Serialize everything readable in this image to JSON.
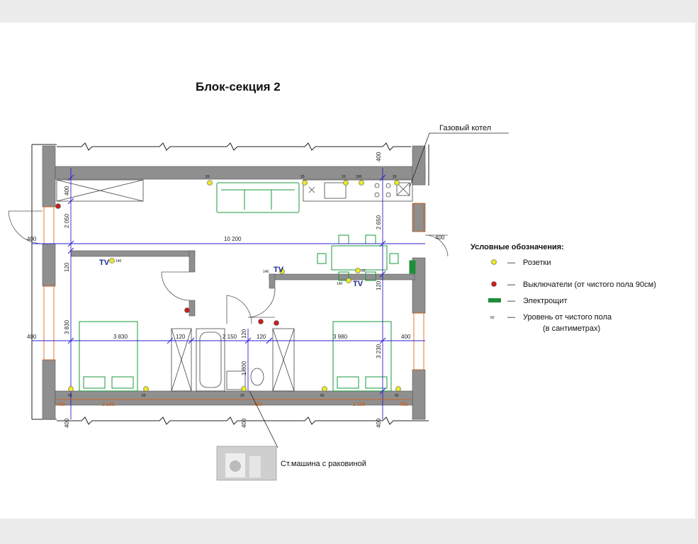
{
  "title": "Блок-секция 2",
  "callouts": {
    "gas_boiler": "Газовый котел",
    "washer": "Ст.машина с раковиной"
  },
  "legend": {
    "title": "Условные обозначения:",
    "items": [
      {
        "symbol": "socket",
        "color": "#e8e82a",
        "dash": "—",
        "label": "Розетки"
      },
      {
        "symbol": "switch",
        "color": "#c81e1e",
        "dash": "—",
        "label": "Выключатели (от чистого пола 90см)"
      },
      {
        "symbol": "panel",
        "color": "#1e8c3a",
        "dash": "—",
        "label": "Электрощит"
      },
      {
        "symbol": "level",
        "sample": "60",
        "dash": "—",
        "label": "Уровень от чистого пола",
        "label2": "(в сантиметрах)"
      }
    ]
  },
  "dimensions": {
    "overall_width": "10 200",
    "left_ext_top": "400",
    "right_ext_top": "400",
    "left_ext_mid": "400",
    "right_ext_mid": "400",
    "top_ext": "400",
    "bottom_ext": "400",
    "bottom_ext_left": "400",
    "kitchen_depth_left": "400",
    "kitchen_h_left": "2 050",
    "kitchen_h_right": "2 650",
    "wall_left": "120",
    "wall_right": "120",
    "bedroom_left_h": "3 830",
    "bedroom_right_h": "3 230",
    "bedroom_left_w": "3 830",
    "bedroom_right_w": "3 980",
    "bath_w": "2 150",
    "wall_a": "120",
    "wall_b": "120",
    "wall_c": "120",
    "bath_depth": "1 800",
    "bed_left_a": "450",
    "bed_left_w": "2 100",
    "bath_b": "460",
    "bed_right_w": "2 100",
    "bed_right_b": "450"
  },
  "levels": {
    "k1": "20",
    "k2": "20",
    "k3": "20",
    "k4": "100",
    "k5": "20",
    "tv_left": "140",
    "tv_right": "140",
    "tv_right_socket": "20",
    "b1": "60",
    "b2": "60",
    "b3": "20",
    "b4": "60",
    "b5": "60"
  },
  "tv_label": "TV",
  "colors": {
    "wall": "#8f8f8f",
    "dim_line": "#2a1fd0",
    "furniture": "#1a9a3c",
    "socket": "#e8e82a",
    "switch": "#c81e1e",
    "orange_dim": "#e05a00"
  }
}
